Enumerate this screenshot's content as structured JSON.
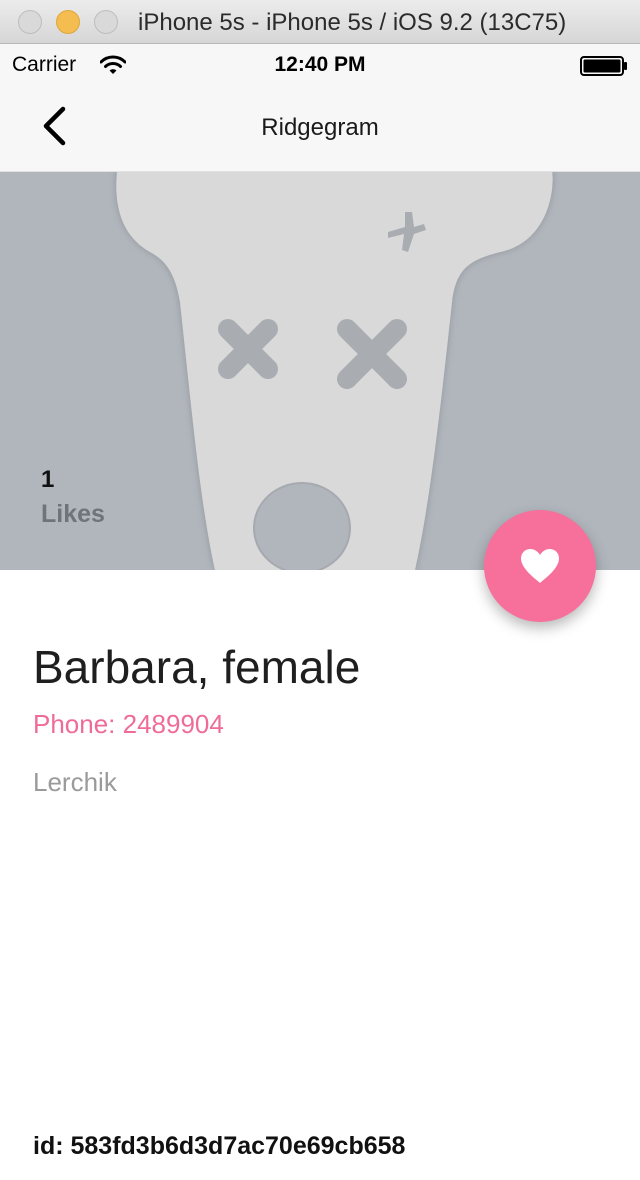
{
  "window": {
    "title": "iPhone 5s - iPhone 5s / iOS 9.2 (13C75)"
  },
  "status_bar": {
    "carrier": "Carrier",
    "time": "12:40 PM",
    "wifi_icon": "wifi-icon",
    "battery_icon": "battery-full-icon"
  },
  "nav": {
    "title": "Ridgegram",
    "back_icon": "chevron-left-icon"
  },
  "hero": {
    "placeholder_icon": "dead-dog-avatar-placeholder",
    "likes_count": "1",
    "likes_label": "Likes"
  },
  "like_button": {
    "icon": "heart-icon"
  },
  "profile": {
    "name": "Barbara, female",
    "phone": "Phone: 2489904",
    "city": "Lerchik",
    "id": "id: 583fd3b6d3d7ac70e69cb658"
  },
  "colors": {
    "accent": "#f76f9b",
    "hero_background": "#b1b6bd",
    "placeholder_shape": "#d9d9d9"
  }
}
